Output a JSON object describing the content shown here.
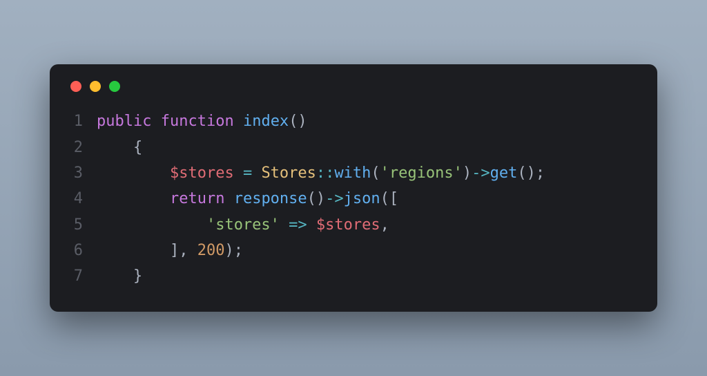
{
  "window": {
    "dots": [
      "red",
      "yellow",
      "green"
    ]
  },
  "code": {
    "lines": [
      {
        "n": "1",
        "tokens": [
          {
            "t": "kw",
            "v": "public"
          },
          {
            "t": "punc",
            "v": " "
          },
          {
            "t": "kw",
            "v": "function"
          },
          {
            "t": "punc",
            "v": " "
          },
          {
            "t": "fn",
            "v": "index"
          },
          {
            "t": "punc",
            "v": "()"
          }
        ]
      },
      {
        "n": "2",
        "tokens": [
          {
            "t": "punc",
            "v": "    {"
          }
        ]
      },
      {
        "n": "3",
        "tokens": [
          {
            "t": "punc",
            "v": "        "
          },
          {
            "t": "var",
            "v": "$stores"
          },
          {
            "t": "punc",
            "v": " "
          },
          {
            "t": "op",
            "v": "="
          },
          {
            "t": "punc",
            "v": " "
          },
          {
            "t": "cls",
            "v": "Stores"
          },
          {
            "t": "op",
            "v": "::"
          },
          {
            "t": "fn",
            "v": "with"
          },
          {
            "t": "punc",
            "v": "("
          },
          {
            "t": "str",
            "v": "'regions'"
          },
          {
            "t": "punc",
            "v": ")"
          },
          {
            "t": "op",
            "v": "->"
          },
          {
            "t": "fn",
            "v": "get"
          },
          {
            "t": "punc",
            "v": "();"
          }
        ]
      },
      {
        "n": "4",
        "tokens": [
          {
            "t": "punc",
            "v": "        "
          },
          {
            "t": "kw",
            "v": "return"
          },
          {
            "t": "punc",
            "v": " "
          },
          {
            "t": "fn",
            "v": "response"
          },
          {
            "t": "punc",
            "v": "()"
          },
          {
            "t": "op",
            "v": "->"
          },
          {
            "t": "fn",
            "v": "json"
          },
          {
            "t": "punc",
            "v": "(["
          }
        ]
      },
      {
        "n": "5",
        "tokens": [
          {
            "t": "punc",
            "v": "            "
          },
          {
            "t": "str",
            "v": "'stores'"
          },
          {
            "t": "punc",
            "v": " "
          },
          {
            "t": "op",
            "v": "=>"
          },
          {
            "t": "punc",
            "v": " "
          },
          {
            "t": "var",
            "v": "$stores"
          },
          {
            "t": "punc",
            "v": ","
          }
        ]
      },
      {
        "n": "6",
        "tokens": [
          {
            "t": "punc",
            "v": "        ], "
          },
          {
            "t": "num",
            "v": "200"
          },
          {
            "t": "punc",
            "v": ");"
          }
        ]
      },
      {
        "n": "7",
        "tokens": [
          {
            "t": "punc",
            "v": "    }"
          }
        ]
      }
    ]
  }
}
